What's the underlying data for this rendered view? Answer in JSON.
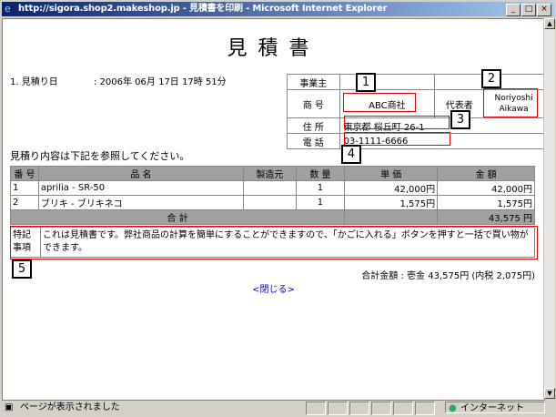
{
  "window": {
    "title": "http://sigora.shop2.makeshop.jp - 見積書を印刷 - Microsoft Internet Explorer",
    "min_glyph": "_",
    "max_glyph": "□",
    "close_glyph": "×"
  },
  "doc": {
    "title": "見積書",
    "date_label": "1. 見積り日",
    "date_value": ": 2006年 06月 17日 17時 51分",
    "instruction": "見積り内容は下記を参照してください。",
    "grand_total": "合計金額 : 壱金 43,575円 (内税 2,075円)",
    "close_link": "<閉じる>"
  },
  "info": {
    "header": "事業主",
    "company_label": "商 号",
    "company_value": "ABC商社",
    "rep_label": "代表者",
    "rep_value": "Noriyoshi Aikawa",
    "address_label": "住 所",
    "address_value": "東京都 桜丘町 26-1",
    "phone_label": "電 話",
    "phone_value": "03-1111-6666"
  },
  "table": {
    "headers": [
      "番 号",
      "品 名",
      "製造元",
      "数 量",
      "単 価",
      "金 額"
    ],
    "rows": [
      {
        "no": "1",
        "name": "aprilia - SR-50",
        "maker": "",
        "qty": "1",
        "unit": "42,000円",
        "amount": "42,000円"
      },
      {
        "no": "2",
        "name": "ブリキ - ブリキネコ",
        "maker": "",
        "qty": "1",
        "unit": "1,575円",
        "amount": "1,575円"
      }
    ],
    "total_label": "合 計",
    "total_value": "43,575 円"
  },
  "remarks": {
    "label": "特記事項",
    "text": "これは見積書です。弊社商品の計算を簡単にすることができますので、「かごに入れる」ボタンを押すと一括で買い物ができます。"
  },
  "badges": [
    "1",
    "2",
    "3",
    "4",
    "5"
  ],
  "status": {
    "text": "ページが表示されました",
    "zone": "インターネット"
  }
}
